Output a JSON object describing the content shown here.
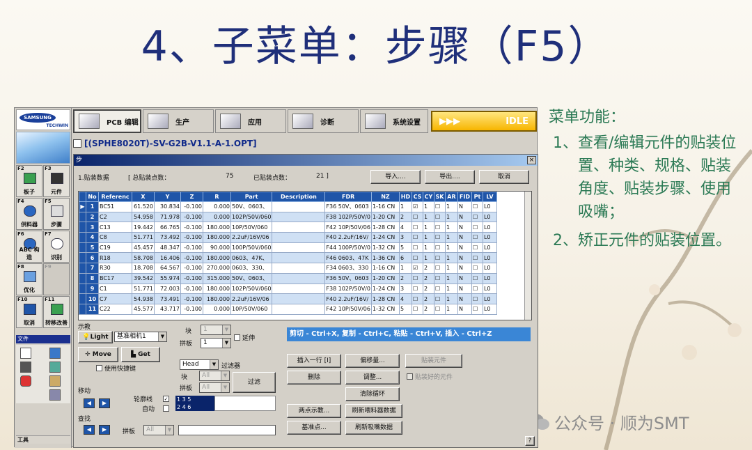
{
  "slide": {
    "title": "4、子菜单：步骤（F5）",
    "desc_head": "菜单功能：",
    "items": [
      {
        "num": "1、",
        "text": "查看/编辑元件的贴装位置、种类、规格、贴装角度、贴装步骤、使用吸嘴；"
      },
      {
        "num": "2、",
        "text": "矫正元件的贴装位置。"
      }
    ],
    "watermark": "公众号 · 顺为SMT"
  },
  "logo": {
    "brand": "SAMSUNG",
    "sub": "TECHWIN"
  },
  "fkeys": [
    {
      "key": "F2",
      "name": "板子"
    },
    {
      "key": "F3",
      "name": "元件"
    },
    {
      "key": "F4",
      "name": "供料器"
    },
    {
      "key": "F5",
      "name": "步骤"
    },
    {
      "key": "F6",
      "name": "ABC 构造"
    },
    {
      "key": "F7",
      "name": "识别"
    },
    {
      "key": "F8",
      "name": "优化"
    },
    {
      "key": "F9",
      "name": ""
    },
    {
      "key": "F10",
      "name": "取消"
    },
    {
      "key": "F11",
      "name": "转移改善"
    }
  ],
  "file_menu": "文件",
  "tool_menu": "工具",
  "toolbar": {
    "tabs": [
      "PCB 编辑",
      "生产",
      "应用",
      "诊断",
      "系统设置"
    ],
    "status_arrows": "▶▶▶",
    "status": "IDLE"
  },
  "path": "[(SPHE8020T)-SV-G2B-V1.1-A-1.OPT]",
  "dialog": {
    "title": "步",
    "close": "×",
    "info_label": "1.贴装数据",
    "total_label": "[ 总贴装点数：",
    "total_value": "75",
    "done_label": "已贴装点数：",
    "done_value": "21 ]",
    "import": "导入....",
    "export": "导出....",
    "cancel": "取消"
  },
  "table": {
    "headers": [
      "No",
      "Referenc",
      "X",
      "Y",
      "Z",
      "R",
      "Part",
      "Description",
      "FDR",
      "NZ",
      "HD",
      "CS",
      "CY",
      "SK",
      "AR",
      "FID",
      "Pt",
      "LV"
    ],
    "rows": [
      [
        "1",
        "BC51",
        "61.520",
        "30.834",
        "-0.100",
        "0.000",
        "50V、0603、",
        "",
        "F36 50V、0603",
        "1-16 CN",
        "1",
        "☑",
        "1",
        "☐",
        "1",
        "N",
        "☐",
        "L0"
      ],
      [
        "2",
        "C2",
        "54.958",
        "71.978",
        "-0.100",
        "0.000",
        "102P/50V/060",
        "",
        "F38 102P/50V/0",
        "1-20 CN",
        "2",
        "☐",
        "1",
        "☐",
        "1",
        "N",
        "☐",
        "L0"
      ],
      [
        "3",
        "C13",
        "19.442",
        "66.765",
        "-0.100",
        "180.000",
        "10P/50V/060",
        "",
        "F42 10P/50V/06",
        "1-28 CN",
        "4",
        "☐",
        "1",
        "☐",
        "1",
        "N",
        "☐",
        "L0"
      ],
      [
        "4",
        "C8",
        "51.771",
        "73.492",
        "-0.100",
        "180.000",
        "2.2uF/16V/06",
        "",
        "F40 2.2uF/16V/",
        "1-24 CN",
        "3",
        "☐",
        "1",
        "☐",
        "1",
        "N",
        "☐",
        "L0"
      ],
      [
        "5",
        "C19",
        "45.457",
        "48.347",
        "-0.100",
        "90.000",
        "100P/50V/060",
        "",
        "F44 100P/50V/0",
        "1-32 CN",
        "5",
        "☐",
        "1",
        "☐",
        "1",
        "N",
        "☐",
        "L0"
      ],
      [
        "6",
        "R18",
        "58.708",
        "16.406",
        "-0.100",
        "180.000",
        "0603、47K、",
        "",
        "F46 0603、47K",
        "1-36 CN",
        "6",
        "☐",
        "1",
        "☐",
        "1",
        "N",
        "☐",
        "L0"
      ],
      [
        "7",
        "R30",
        "18.708",
        "64.567",
        "-0.100",
        "270.000",
        "0603、330、",
        "",
        "F34 0603、330",
        "1-16 CN",
        "1",
        "☑",
        "2",
        "☐",
        "1",
        "N",
        "☐",
        "L0"
      ],
      [
        "8",
        "BC17",
        "39.542",
        "55.974",
        "-0.100",
        "315.000",
        "50V、0603、",
        "",
        "F36 50V、0603",
        "1-20 CN",
        "2",
        "☐",
        "2",
        "☐",
        "1",
        "N",
        "☐",
        "L0"
      ],
      [
        "9",
        "C1",
        "51.771",
        "72.003",
        "-0.100",
        "180.000",
        "102P/50V/060",
        "",
        "F38 102P/50V/0",
        "1-24 CN",
        "3",
        "☐",
        "2",
        "☐",
        "1",
        "N",
        "☐",
        "L0"
      ],
      [
        "10",
        "C7",
        "54.938",
        "73.491",
        "-0.100",
        "180.000",
        "2.2uF/16V/06",
        "",
        "F40 2.2uF/16V/",
        "1-28 CN",
        "4",
        "☐",
        "2",
        "☐",
        "1",
        "N",
        "☐",
        "L0"
      ],
      [
        "11",
        "C22",
        "45.577",
        "43.717",
        "-0.100",
        "0.000",
        "10P/50V/060",
        "",
        "F42 10P/50V/06",
        "1-32 CN",
        "5",
        "☐",
        "2",
        "☐",
        "1",
        "N",
        "☐",
        "L0"
      ]
    ]
  },
  "bottom": {
    "show_label": "示教",
    "light": "Light",
    "camera": "基准相机1",
    "move": "Move",
    "get": "Get",
    "shortcut_key": "使用快捷键",
    "block_label": "块",
    "block_val": "1",
    "extend": "延伸",
    "panel_label": "拼板",
    "panel_val": "1",
    "shortcut_bar": "剪切 - Ctrl+X, 复制 - Ctrl+C, 粘贴 - Ctrl+V, 插入 - Ctrl+Z",
    "filter_label": "过滤器",
    "head": "Head",
    "f_block": "块",
    "f_panel": "拼板",
    "all": "All",
    "filter_btn": "过滤",
    "head_list_1": "1   3   5",
    "head_list_2": "2   4   6",
    "move_label": "移动",
    "contour": "轮廓线",
    "auto": "自动",
    "find_label": "查找",
    "find_panel": "拼板",
    "find_all": "All",
    "insert_row": "插入一行 [I]",
    "offset": "偏移量...",
    "mount_part": "贴装元件",
    "delete": "删除",
    "adjust": "调整...",
    "mounted_part": "贴装好的元件",
    "clear_loop": "清除循环",
    "two_point": "两点示教...",
    "refresh_feeder": "刷新喂料器数据",
    "ref_point": "基准点...",
    "refresh_nozzle": "刷新吸嘴数据",
    "help": "?"
  }
}
